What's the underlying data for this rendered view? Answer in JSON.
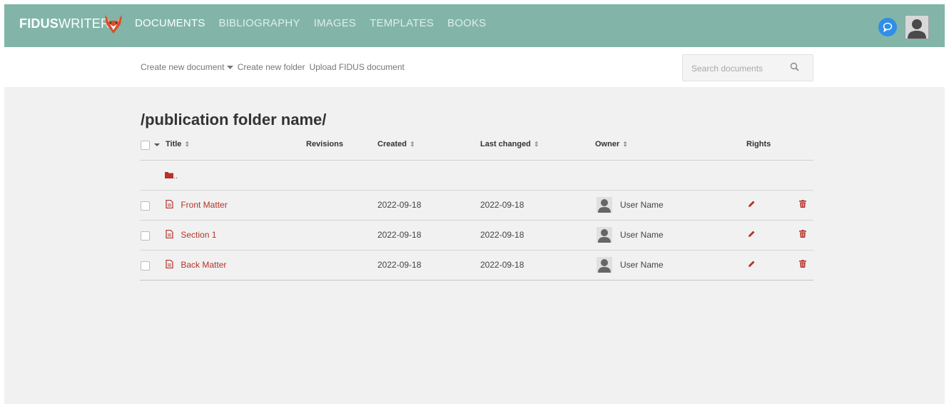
{
  "brand": {
    "bold": "FIDUS",
    "light": "WRITER"
  },
  "nav": [
    {
      "label": "DOCUMENTS",
      "active": true
    },
    {
      "label": "BIBLIOGRAPHY",
      "active": false
    },
    {
      "label": "IMAGES",
      "active": false
    },
    {
      "label": "TEMPLATES",
      "active": false
    },
    {
      "label": "BOOKS",
      "active": false
    }
  ],
  "header_icons": {
    "chat": "chat-bubble-icon",
    "avatar": "user-avatar"
  },
  "actions": {
    "create_doc": "Create new document",
    "create_folder": "Create new folder",
    "upload": "Upload FIDUS document"
  },
  "search": {
    "placeholder": "Search documents",
    "value": ""
  },
  "folder": {
    "path": "/publication folder name/",
    "parent_label": ".."
  },
  "columns": {
    "title": "Title",
    "revisions": "Revisions",
    "created": "Created",
    "last_changed": "Last changed",
    "owner": "Owner",
    "rights": "Rights"
  },
  "documents": [
    {
      "title": "Front Matter",
      "revisions": "",
      "created": "2022-09-18",
      "last_changed": "2022-09-18",
      "owner": "User Name"
    },
    {
      "title": "Section 1",
      "revisions": "",
      "created": "2022-09-18",
      "last_changed": "2022-09-18",
      "owner": "User Name"
    },
    {
      "title": "Back Matter",
      "revisions": "",
      "created": "2022-09-18",
      "last_changed": "2022-09-18",
      "owner": "User Name"
    }
  ],
  "colors": {
    "topbar": "#82b5a8",
    "accent_red": "#b5332a",
    "chat_blue": "#2f8ee8",
    "background": "#f1f1f1"
  }
}
